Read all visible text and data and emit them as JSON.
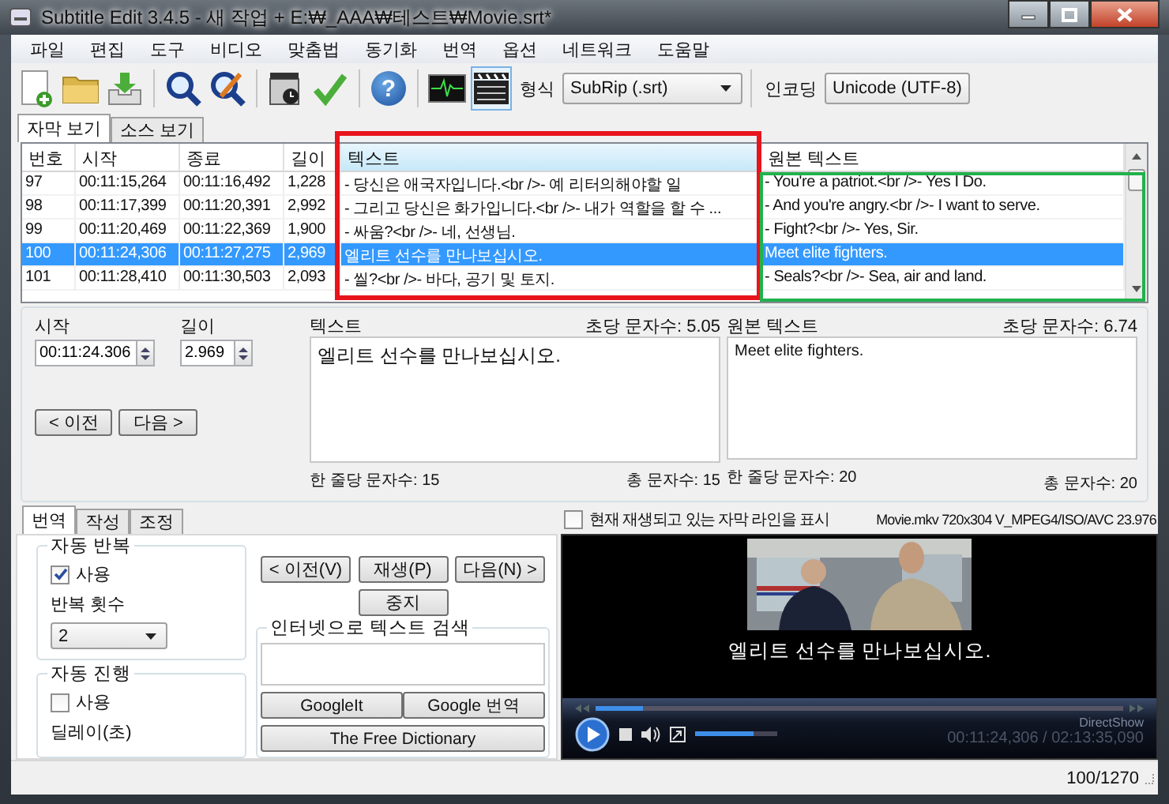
{
  "window": {
    "title": "Subtitle Edit 3.4.5 - 새 작업 + E:₩_AAA₩테스트₩Movie.srt*"
  },
  "menu": [
    "파일",
    "편집",
    "도구",
    "비디오",
    "맞춤법",
    "동기화",
    "번역",
    "옵션",
    "네트워크",
    "도움말"
  ],
  "toolbar": {
    "help_glyph": "?",
    "waveform_on": false,
    "video_on": true,
    "format_label": "형식",
    "format": "SubRip (.srt)",
    "encoding_label": "인코딩",
    "encoding": "Unicode (UTF-8)"
  },
  "view_tabs": [
    {
      "label": "자막 보기",
      "selected": true
    },
    {
      "label": "소스 보기",
      "selected": false
    }
  ],
  "grid": {
    "columns": [
      {
        "label": "번호",
        "selected": false
      },
      {
        "label": "시작",
        "selected": false
      },
      {
        "label": "종료",
        "selected": false
      },
      {
        "label": "길이",
        "selected": false
      },
      {
        "label": "텍스트",
        "selected": true
      },
      {
        "label": "원본 텍스트",
        "selected": false
      }
    ],
    "rows": [
      {
        "cells": [
          "97",
          "00:11:15,264",
          "00:11:16,492",
          "1,228",
          "- 당신은 애국자입니다.<br />- 예 리터의해야할 일",
          "- You're a patriot.<br />- Yes I Do."
        ],
        "selected": false
      },
      {
        "cells": [
          "98",
          "00:11:17,399",
          "00:11:20,391",
          "2,992",
          "- 그리고 당신은 화가입니다.<br />- 내가 역할을 할 수 ...",
          "- And you're angry.<br />- I want to serve."
        ],
        "selected": false
      },
      {
        "cells": [
          "99",
          "00:11:20,469",
          "00:11:22,369",
          "1,900",
          "- 싸움?<br />- 네, 선생님.",
          "- Fight?<br />- Yes, Sir."
        ],
        "selected": false
      },
      {
        "cells": [
          "100",
          "00:11:24,306",
          "00:11:27,275",
          "2,969",
          "엘리트 선수를 만나보십시오.",
          "Meet elite fighters."
        ],
        "selected": true
      },
      {
        "cells": [
          "101",
          "00:11:28,410",
          "00:11:30,503",
          "2,093",
          "- 씰?<br />- 바다, 공기 및 토지.",
          "- Seals?<br />- Sea, air and land."
        ],
        "selected": false
      }
    ]
  },
  "annotations": [
    {
      "kind": "highlight-box",
      "color": "#e8141c"
    },
    {
      "kind": "highlight-box",
      "color": "#22b14c"
    }
  ],
  "editor": {
    "start_label": "시작",
    "start": "00:11:24.306",
    "duration_label": "길이",
    "duration": "2.969",
    "prev": "< 이전",
    "next": "다음 >",
    "text": {
      "label": "텍스트",
      "cps": "초당 문자수: 5.05",
      "value": "엘리트 선수를 만나보십시오.",
      "line_chars": "한 줄당 문자수: 15",
      "total_chars": "총 문자수: 15"
    },
    "original": {
      "label": "원본 텍스트",
      "cps": "초당 문자수: 6.74",
      "value": "Meet elite fighters.",
      "line_chars": "한 줄당 문자수: 20",
      "total_chars": "총 문자수: 20"
    }
  },
  "bottom_tabs": [
    {
      "label": "번역",
      "selected": true
    },
    {
      "label": "작성",
      "selected": false
    },
    {
      "label": "조정",
      "selected": false
    }
  ],
  "auto_repeat": {
    "title": "자동 반복",
    "use_label": "사용",
    "checked": true,
    "count_label": "반복 횟수",
    "count": "2"
  },
  "auto_continue": {
    "title": "자동 진행",
    "use_label": "사용",
    "checked": false,
    "delay_label": "딜레이(초)"
  },
  "playback_buttons": [
    "< 이전(V)",
    "재생(P)",
    "다음(N) >",
    "중지"
  ],
  "search": {
    "title": "인터넷으로 텍스트 검색",
    "buttons": [
      "GoogleIt",
      "Google 번역",
      "The Free Dictionary"
    ]
  },
  "video": {
    "show_current_label": "현재 재생되고 있는 자막 라인을 표시",
    "show_current": false,
    "info": "Movie.mkv 720x304 V_MPEG4/ISO/AVC 23.976",
    "subtitle": "엘리트 선수를 만나보십시오.",
    "renderer": "DirectShow",
    "time": "00:11:24,306 / 02:13:35,090",
    "position": {
      "level": 0.09
    },
    "volume": {
      "level": 0.72
    }
  },
  "status_bar": {
    "position": "100/1270"
  }
}
